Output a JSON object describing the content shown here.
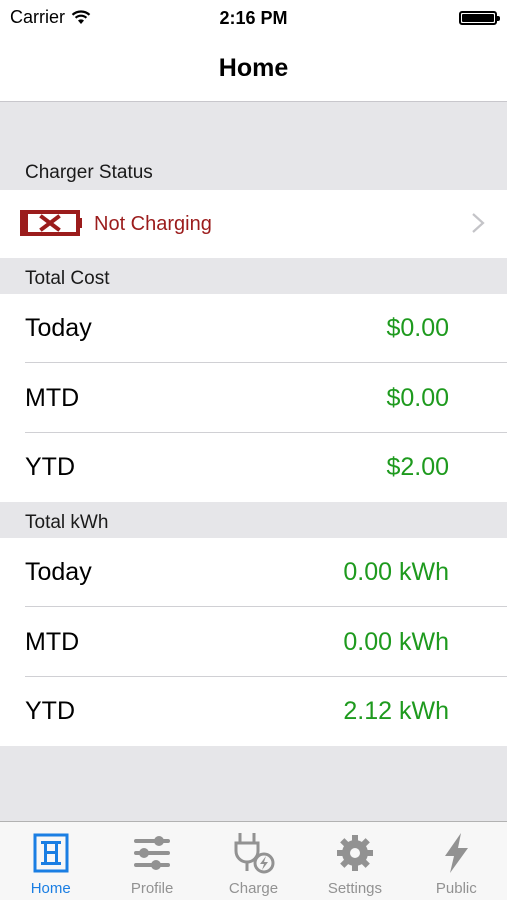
{
  "status_bar": {
    "carrier": "Carrier",
    "time": "2:16 PM"
  },
  "nav": {
    "title": "Home"
  },
  "charger_status": {
    "header": "Charger Status",
    "status": "Not Charging",
    "status_color": "#9b1c1c"
  },
  "total_cost": {
    "header": "Total Cost",
    "rows": [
      {
        "label": "Today",
        "value": "$0.00"
      },
      {
        "label": "MTD",
        "value": "$0.00"
      },
      {
        "label": "YTD",
        "value": "$2.00"
      }
    ]
  },
  "total_kwh": {
    "header": "Total kWh",
    "rows": [
      {
        "label": "Today",
        "value": "0.00 kWh"
      },
      {
        "label": "MTD",
        "value": "0.00 kWh"
      },
      {
        "label": "YTD",
        "value": "2.12 kWh"
      }
    ]
  },
  "colors": {
    "value_green": "#1e9a1e",
    "tab_active": "#1a7ee3",
    "tab_inactive": "#929292"
  },
  "tabs": [
    {
      "label": "Home",
      "icon": "home-icon",
      "active": true
    },
    {
      "label": "Profile",
      "icon": "sliders-icon",
      "active": false
    },
    {
      "label": "Charge",
      "icon": "plug-icon",
      "active": false
    },
    {
      "label": "Settings",
      "icon": "gear-icon",
      "active": false
    },
    {
      "label": "Public",
      "icon": "lightning-icon",
      "active": false
    }
  ]
}
